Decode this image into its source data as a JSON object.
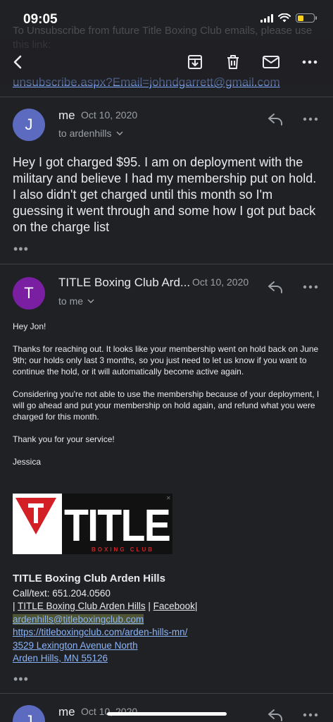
{
  "status": {
    "time": "09:05"
  },
  "ghost": {
    "text": "To Unsubscribe from future Title Boxing Club emails, please use this link:",
    "link": "unsubscribe.aspx?Email=johndgarrett@gmail.com"
  },
  "toolbar": {
    "back_icon": "back-arrow-icon",
    "archive_icon": "archive-icon",
    "delete_icon": "trash-icon",
    "mail_icon": "mail-icon",
    "more_icon": "more-vertical-icon"
  },
  "msg1": {
    "avatar": "J",
    "avatar_color": "#5c6bc0",
    "sender": "me",
    "date": "Oct 10, 2020",
    "to": "to ardenhills",
    "body": "Hey I got charged $95. I am on deployment with the military and believe I had my membership put on hold. I also didn't get charged until this month so I'm guessing it went through and some how I got put back on the charge list",
    "dots": "•••"
  },
  "msg2": {
    "avatar": "T",
    "avatar_color": "#7b1fa2",
    "sender": "TITLE Boxing Club Ard...",
    "date": "Oct 10, 2020",
    "to": "to me",
    "greeting": "Hey Jon!",
    "para1": "Thanks for reaching out.  It looks like your membership went on hold back on June 9th; our holds only last 3 months, so you just need to let us know if you want to continue the hold, or it will automatically become active again.",
    "para2": "Considering you're not able to use the membership because of your deployment, I will go ahead and put your membership on hold again, and refund what you were charged for this month.",
    "para3": "Thank you for your service!",
    "signoff": "Jessica",
    "logo_text": "TITLE",
    "logo_sub": "BOXING CLUB",
    "sig_name": "TITLE Boxing Club Arden Hills",
    "sig_phone": "Call/text: 651.204.0560",
    "sig_pipe1": "| ",
    "sig_link1": "TITLE Boxing Club Arden Hills",
    "sig_pipe2": " | ",
    "sig_link2": "Facebook",
    "sig_pipe3": "|",
    "sig_email": "ardenhills@titleboxingclub.com",
    "sig_url": "https://titleboxingclub.com/arden-hills-mn/",
    "sig_addr1": "3529 Lexington Avenue North",
    "sig_addr2": "Arden Hills, MN 55126",
    "dots": "•••"
  },
  "msg3": {
    "avatar": "J",
    "avatar_color": "#5c6bc0",
    "sender": "me",
    "date": "Oct 10, 2020"
  }
}
